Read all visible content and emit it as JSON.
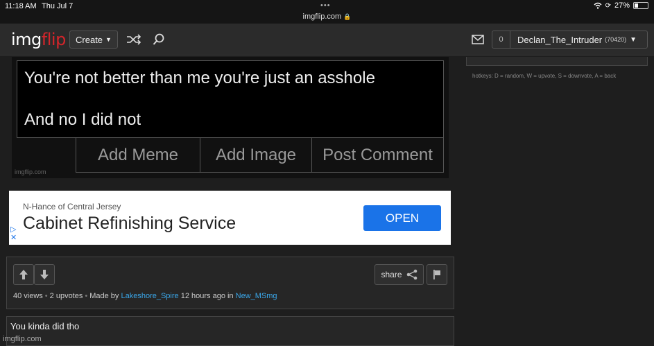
{
  "status_bar": {
    "time": "11:18 AM",
    "date": "Thu Jul 7",
    "dots": "•••",
    "url": "imgflip.com",
    "battery": "27%"
  },
  "header": {
    "logo_part1": "img",
    "logo_part2": "flip",
    "create_label": "Create",
    "notif_count": "0",
    "username": "Declan_The_Intruder",
    "points": "(70420)"
  },
  "sidebar": {
    "hotkeys": "hotkeys: D = random, W = upvote, S = downvote, A = back"
  },
  "editor": {
    "text": "You're not better than me you're just an asshole\n\nAnd no I did not",
    "buttons": [
      "Add Meme",
      "Add Image",
      "Post Comment"
    ],
    "watermark": "imgflip.com"
  },
  "ad": {
    "advertiser": "N-Hance of Central Jersey",
    "title": "Cabinet Refinishing Service",
    "button": "OPEN"
  },
  "meme_info": {
    "share_label": "share",
    "views": "40 views",
    "upvotes": "2 upvotes",
    "made_by_prefix": "Made by",
    "author": "Lakeshore_Spire",
    "time_prefix": "12 hours ago in",
    "stream": "New_MSmg"
  },
  "comment": {
    "text": "You kinda did tho"
  },
  "bottom_watermark": "imgflip.com"
}
